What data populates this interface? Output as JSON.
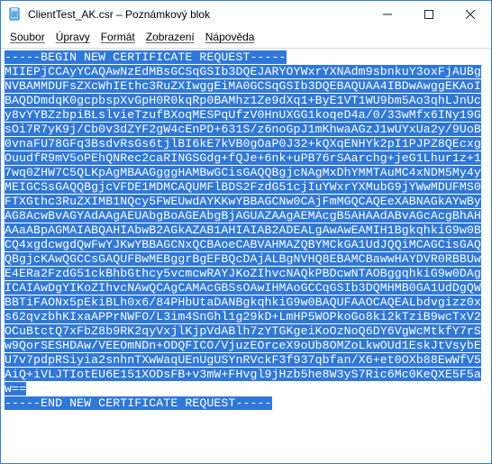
{
  "titlebar": {
    "title": "ClientTest_AK.csr – Poznámkový blok"
  },
  "menubar": {
    "items": [
      {
        "label": "Soubor"
      },
      {
        "label": "Úpravy"
      },
      {
        "label": "Formát"
      },
      {
        "label": "Zobrazení"
      },
      {
        "label": "Nápověda"
      }
    ]
  },
  "content": {
    "text": "-----BEGIN NEW CERTIFICATE REQUEST-----\nMIIEPjCCAyYCAQAwNzEdMBsGCSqGSIb3DQEJARYOYWxrYXNAdm9sbnkuY3oxFjAUBgNVBAMMDUFsZXcWhIEthc3RuZXIwggEiMA0GCSqGSIb3DQEBAQUAA4IBDwAwggEKAoIBAQDDmdqK0gcpbspXvGpH0R0kqRp0BAMhz1Ze9dXq1+ByE1VT1WU9bm5Ao3qhLJnUcy8vYYBZzbpiBLslvieTzufBXoqMESPqUfzV0HnUXGG1koqeD4a/0/33wMfx6INy19GsOi7R7yK9j/Cb0v3dZYF2gW4cEnPD+631S/z6noGpJ1mKhwaAGzJ1wUYxUa2y/9UoB0vnaFU78GFq3BsdvRsGs6tjlBI6kE7kVB0gOaP0J32+kQXqENHYk2pI1PJPZ8QEcxgOuudfR9mV5oPEhQNRec2caRINGSGdg+fQJe+6nk+uPB76rSAarchg+jeG1Lhur1z+17wq0ZHW7C5QLKpAgMBAAGgggHAMBwGCisGAQQBgjcNAgMxDhYMMTAuMC4xNDM5My4yMEIGCSsGAQQBgjcVFDE1MDMCAQUMFlBDS2FzdG51cjIuYWxrYXMubG9jYWwMDUFMS0FTXGthc3RuZXIMB1NQcy5FWEUwdAYKKwYBBAGCNw0CAjFmMGQCAQEeXABNAGkAYwByAG8AcwBvAGYAdAAgAEUAbgBoAGEAbgBjAGUAZAAgAEMAcgB5AHAAdABvAGcAcgBhAHAAaABpAGMAIABQAHIAbwB2AGkAZAB1AHIAIAB2ADEALgAwAwEAMIH1BgkqhkiG9w0BCQ4xgdcwgdQwFwYJKwYBBAGCNxQCBAoeCABVAHMAZQBYMCkGA1UdJQQiMCAGCisGAQQBgjcKAwQGCCsGAQUFBwMEBggrBgEFBQcDAjALBgNVHQ8EBAMCBawwHAYDVR0RBBUwE4ERa2FzdG51ckBhbGthcy5vcmcwRAYJKoZIhvcNAQkPBDcwNTAOBggqhkiG9w0DAgICAIAwDgYIKoZIhvcNAwQCAgCAMAcGBSsOAwIHMAoGCCqGSIb3DQMHMB0GA1UdDgQWBBTiFAONx5pEkiBLh0x6/84PHbUtaDANBgkqhkiG9w0BAQUFAAOCAQEALbdvgizz0xs62qvzbhKIxaAPPrNWFO/L3im4SnGhl1g29kD+LmHP5WOPkoGo8ki2kTziB9wcTxV2OCuBtctQ7xFbZ8b9RK2qyVxjlKjpVdABlh7zYTGKgeiKoOzNoQ6DY6VgWcMtkfY7rSw9QorSESHDAw/VEEOmNDn+ODQFICO/VjuzEOrceX9oUb8OMZoLkwOUd1EskJtVsybEU7v7pdpRSiyia2snhnTXwWaqUEnUgUSYnRVckF3f937qbfan/X6+et0OXb88EwWfV5AiQ+iVLJTIotEU6E151XODsFB+v3mW+FHvgl9jHzb5he8W3yS7Ric6Mc0KeQXE5F5aw==\n-----END NEW CERTIFICATE REQUEST-----"
  }
}
